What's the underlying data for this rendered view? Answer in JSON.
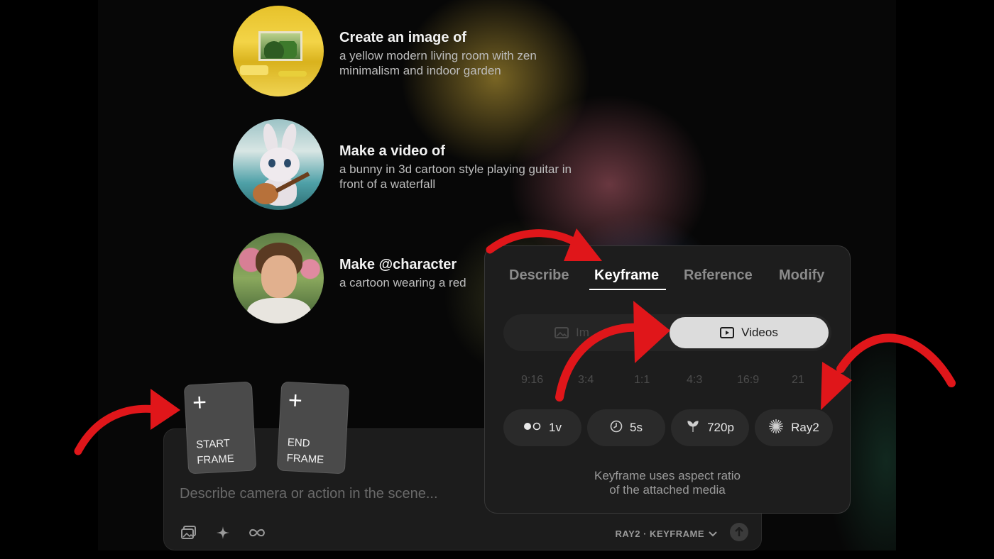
{
  "suggestions": [
    {
      "title": "Create an image of",
      "desc": "a yellow modern living room with zen minimalism and indoor garden",
      "thumb": "yellow-living-room"
    },
    {
      "title": "Make a video of",
      "desc": "a bunny in 3d cartoon style playing guitar in front of a waterfall",
      "thumb": "bunny-guitar"
    },
    {
      "title": "Make @character",
      "desc": "a cartoon wearing a red",
      "thumb": "young-man-portrait"
    }
  ],
  "frames": {
    "start": {
      "plus": "+",
      "label": "START\nFRAME"
    },
    "end": {
      "plus": "+",
      "label": "END\nFRAME"
    }
  },
  "prompt": {
    "placeholder": "Describe camera or action in the scene...",
    "tools": [
      "image-icon",
      "sparkle-icon",
      "infinity-icon"
    ],
    "model_label": "RAY2 · KEYFRAME",
    "send_icon": "arrow-up-icon"
  },
  "panel": {
    "tabs": [
      "Describe",
      "Keyframe",
      "Reference",
      "Modify"
    ],
    "active_tab": "Keyframe",
    "toggle": {
      "images_label": "Im",
      "videos_label": "Videos",
      "selected": "Videos"
    },
    "ratios": [
      "9:16",
      "3:4",
      "1:1",
      "4:3",
      "16:9",
      "21"
    ],
    "options": [
      {
        "icon": "variations-icon",
        "label": "1v"
      },
      {
        "icon": "clock-icon",
        "label": "5s"
      },
      {
        "icon": "resolution-icon",
        "label": "720p"
      },
      {
        "icon": "model-burst-icon",
        "label": "Ray2"
      }
    ],
    "note_line1": "Keyframe uses aspect ratio",
    "note_line2": "of the attached media"
  },
  "colors": {
    "arrow": "#e0161a",
    "panel_bg": "#1d1d1d",
    "toggle_selected": "#dcdcdc"
  }
}
